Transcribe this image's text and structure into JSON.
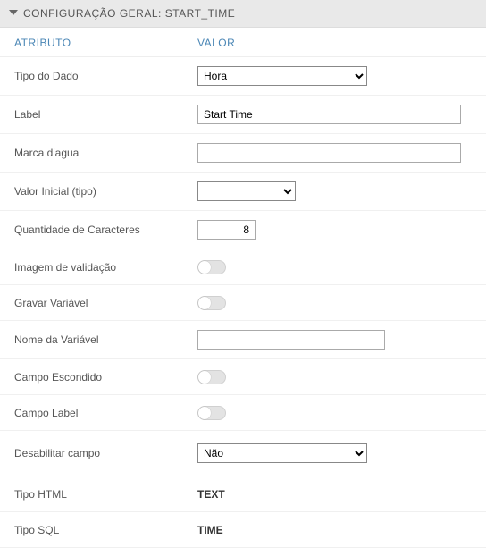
{
  "header": {
    "title": "CONFIGURAÇÃO GERAL: START_TIME"
  },
  "columns": {
    "attr": "ATRIBUTO",
    "val": "VALOR"
  },
  "rows": {
    "tipoDado": {
      "label": "Tipo do Dado",
      "value": "Hora"
    },
    "label": {
      "label": "Label",
      "value": "Start Time"
    },
    "marcaDagua": {
      "label": "Marca d'agua",
      "value": ""
    },
    "valorInicial": {
      "label": "Valor Inicial (tipo)",
      "value": ""
    },
    "qtdCaracteres": {
      "label": "Quantidade de Caracteres",
      "value": "8"
    },
    "imagemValidacao": {
      "label": "Imagem de validação"
    },
    "gravarVariavel": {
      "label": "Gravar Variável"
    },
    "nomeVariavel": {
      "label": "Nome da Variável",
      "value": ""
    },
    "campoEscondido": {
      "label": "Campo Escondido"
    },
    "campoLabel": {
      "label": "Campo Label"
    },
    "desabilitarCampo": {
      "label": "Desabilitar campo",
      "value": "Não"
    },
    "tipoHtml": {
      "label": "Tipo HTML",
      "value": "TEXT"
    },
    "tipoSql": {
      "label": "Tipo SQL",
      "value": "TIME"
    }
  }
}
